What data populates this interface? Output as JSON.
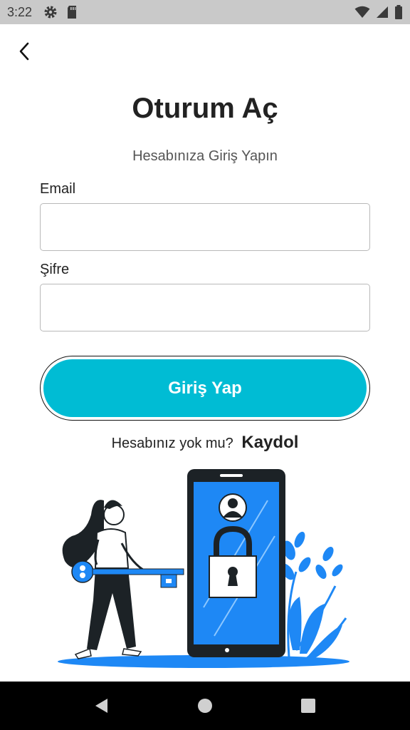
{
  "status_bar": {
    "time": "3:22",
    "left_icons": [
      "gear-icon",
      "sd-card-icon"
    ],
    "right_icons": [
      "wifi-icon",
      "signal-icon",
      "battery-icon"
    ]
  },
  "header": {
    "back_icon": "chevron-left-icon",
    "title": "Oturum Aç",
    "subtitle": "Hesabınıza Giriş Yapın"
  },
  "form": {
    "email_label": "Email",
    "email_value": "",
    "password_label": "Şifre",
    "password_value": "",
    "submit_label": "Giriş Yap"
  },
  "signup": {
    "prompt": "Hesabınız yok mu?",
    "link": "Kaydol"
  },
  "colors": {
    "accent": "#00bcd4",
    "illustration_blue": "#1e88f5",
    "dark": "#1c2226"
  },
  "nav_bar": {
    "icons": [
      "back-triangle-icon",
      "home-circle-icon",
      "recents-square-icon"
    ]
  }
}
